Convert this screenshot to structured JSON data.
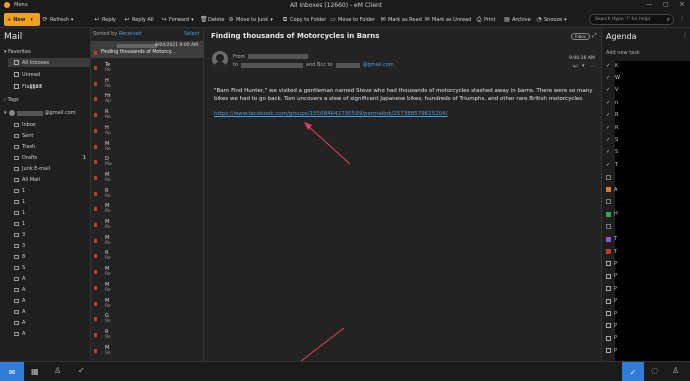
{
  "window": {
    "menu_label": "Menu",
    "title": "All Inboxes (12660) - eM Client"
  },
  "toolbar": {
    "new_label": "New",
    "refresh_label": "Refresh",
    "reply_label": "Reply",
    "reply_all_label": "Reply All",
    "forward_label": "Forward",
    "delete_label": "Delete",
    "move_to_junk_label": "Move to Junk",
    "copy_to_folder_label": "Copy to Folder",
    "move_to_folder_label": "Move to Folder",
    "mark_as_read_label": "Mark as Read",
    "mark_as_unread_label": "Mark as Unread",
    "print_label": "Print",
    "archive_label": "Archive",
    "snooze_label": "Snooze",
    "search_placeholder": "Search (type '?' for help)"
  },
  "sidebar": {
    "title": "Mail",
    "favorites_label": "Favorites",
    "favorites": [
      {
        "label": "All Inboxes",
        "icon": "inbox-icon"
      },
      {
        "label": "Unread",
        "icon": "unread-icon"
      },
      {
        "label": "Flagged",
        "icon": "flag-icon",
        "count": "1517"
      }
    ],
    "tags_label": "Tags",
    "account_label": "@gmail.com",
    "folders": [
      {
        "label": "Inbox",
        "icon": "inbox-icon"
      },
      {
        "label": "Sent",
        "icon": "sent-icon"
      },
      {
        "label": "Trash",
        "icon": "trash-icon"
      },
      {
        "label": "Drafts",
        "icon": "drafts-icon",
        "count": "1"
      },
      {
        "label": "Junk E-mail",
        "icon": "junk-icon"
      },
      {
        "label": "All Mail",
        "icon": "all-mail-icon"
      },
      {
        "label": "1",
        "icon": "folder-icon"
      },
      {
        "label": "1",
        "icon": "folder-icon"
      },
      {
        "label": "1",
        "icon": "folder-icon"
      },
      {
        "label": "1",
        "icon": "folder-icon"
      },
      {
        "label": "3",
        "icon": "folder-icon"
      },
      {
        "label": "3",
        "icon": "folder-icon"
      },
      {
        "label": "8",
        "icon": "folder-icon"
      },
      {
        "label": "S",
        "icon": "folder-icon"
      },
      {
        "label": "A",
        "icon": "folder-icon"
      },
      {
        "label": "A",
        "icon": "folder-icon"
      },
      {
        "label": "A",
        "icon": "folder-icon"
      },
      {
        "label": "A",
        "icon": "folder-icon"
      },
      {
        "label": "A",
        "icon": "folder-icon"
      },
      {
        "label": "A",
        "icon": "folder-icon"
      }
    ]
  },
  "message_list": {
    "sorted_by_label": "Sorted by",
    "sort_field": "Received",
    "select_label": "Select",
    "selected_item": {
      "date": "8/04/2021 9:00 AM",
      "subject": "Finding thousands of Motorcy..."
    },
    "rows": [
      {
        "l1": "Te",
        "l2": "Re"
      },
      {
        "l1": "H",
        "l2": "Re"
      },
      {
        "l1": "Hr",
        "l2": "Ap"
      },
      {
        "l1": "R",
        "l2": "Re"
      },
      {
        "l1": "H",
        "l2": "Ap"
      },
      {
        "l1": "M",
        "l2": "Re"
      },
      {
        "l1": "D",
        "l2": "Ma"
      },
      {
        "l1": "M",
        "l2": "Re"
      },
      {
        "l1": "R",
        "l2": "Re"
      },
      {
        "l1": "M",
        "l2": "Re"
      },
      {
        "l1": "M",
        "l2": "Re"
      },
      {
        "l1": "M",
        "l2": "Re"
      },
      {
        "l1": "R",
        "l2": "Re"
      },
      {
        "l1": "M",
        "l2": "Re"
      },
      {
        "l1": "M",
        "l2": "Re"
      },
      {
        "l1": "M",
        "l2": "Re"
      },
      {
        "l1": "G",
        "l2": "Re"
      },
      {
        "l1": "R",
        "l2": "Re"
      },
      {
        "l1": "M",
        "l2": "Re"
      }
    ]
  },
  "reading": {
    "subject": "Finding thousands of Motorcycles in Barns",
    "tag": "Inbox",
    "from_label": "From",
    "to_label": "to",
    "and_bcc": "and Bcc to",
    "bcc_email": "@gmail.com",
    "time": "9:00:16 AM",
    "body": "\"Barn Find Hunter,\" we visited a gentleman named Steve who had thousands of motorcycles stashed away in barns. There were so many bikes we had to go back. Tom uncovers a slew of significant Japanese bikes, hundreds of Triumphs, and other rare British motorcycles.",
    "link": "https://www.facebook.com/groups/155684642795599/permalink/257388579625204/",
    "status_url": "https://www.facebook.com/groups/155684642795599/permalink/257388579625204/"
  },
  "agenda": {
    "title": "Agenda",
    "add_task_placeholder": "Add new task",
    "items": [
      {
        "kind": "check",
        "label": "K"
      },
      {
        "kind": "check",
        "label": "W"
      },
      {
        "kind": "check",
        "label": "V"
      },
      {
        "kind": "check",
        "label": "n"
      },
      {
        "kind": "check",
        "label": "R"
      },
      {
        "kind": "check",
        "label": "R"
      },
      {
        "kind": "check",
        "label": "S"
      },
      {
        "kind": "check",
        "label": "S"
      },
      {
        "kind": "check",
        "label": "T"
      },
      {
        "kind": "box",
        "label": ""
      },
      {
        "kind": "orange",
        "label": "A"
      },
      {
        "kind": "box",
        "label": ""
      },
      {
        "kind": "green",
        "label": "H"
      },
      {
        "kind": "box",
        "label": ""
      },
      {
        "kind": "purple",
        "label": "T"
      },
      {
        "kind": "red",
        "label": "T"
      },
      {
        "kind": "cal",
        "label": "P"
      },
      {
        "kind": "cal",
        "label": "P"
      },
      {
        "kind": "cal",
        "label": "P"
      },
      {
        "kind": "cal",
        "label": "P"
      },
      {
        "kind": "cal",
        "label": "P"
      },
      {
        "kind": "cal",
        "label": "P"
      },
      {
        "kind": "cal",
        "label": "P"
      },
      {
        "kind": "cal",
        "label": "P"
      }
    ]
  },
  "colors": {
    "accent": "#f0a020",
    "link": "#4a9ee0",
    "selected_nav": "#2f7bd6",
    "flag": "#c0392b"
  }
}
